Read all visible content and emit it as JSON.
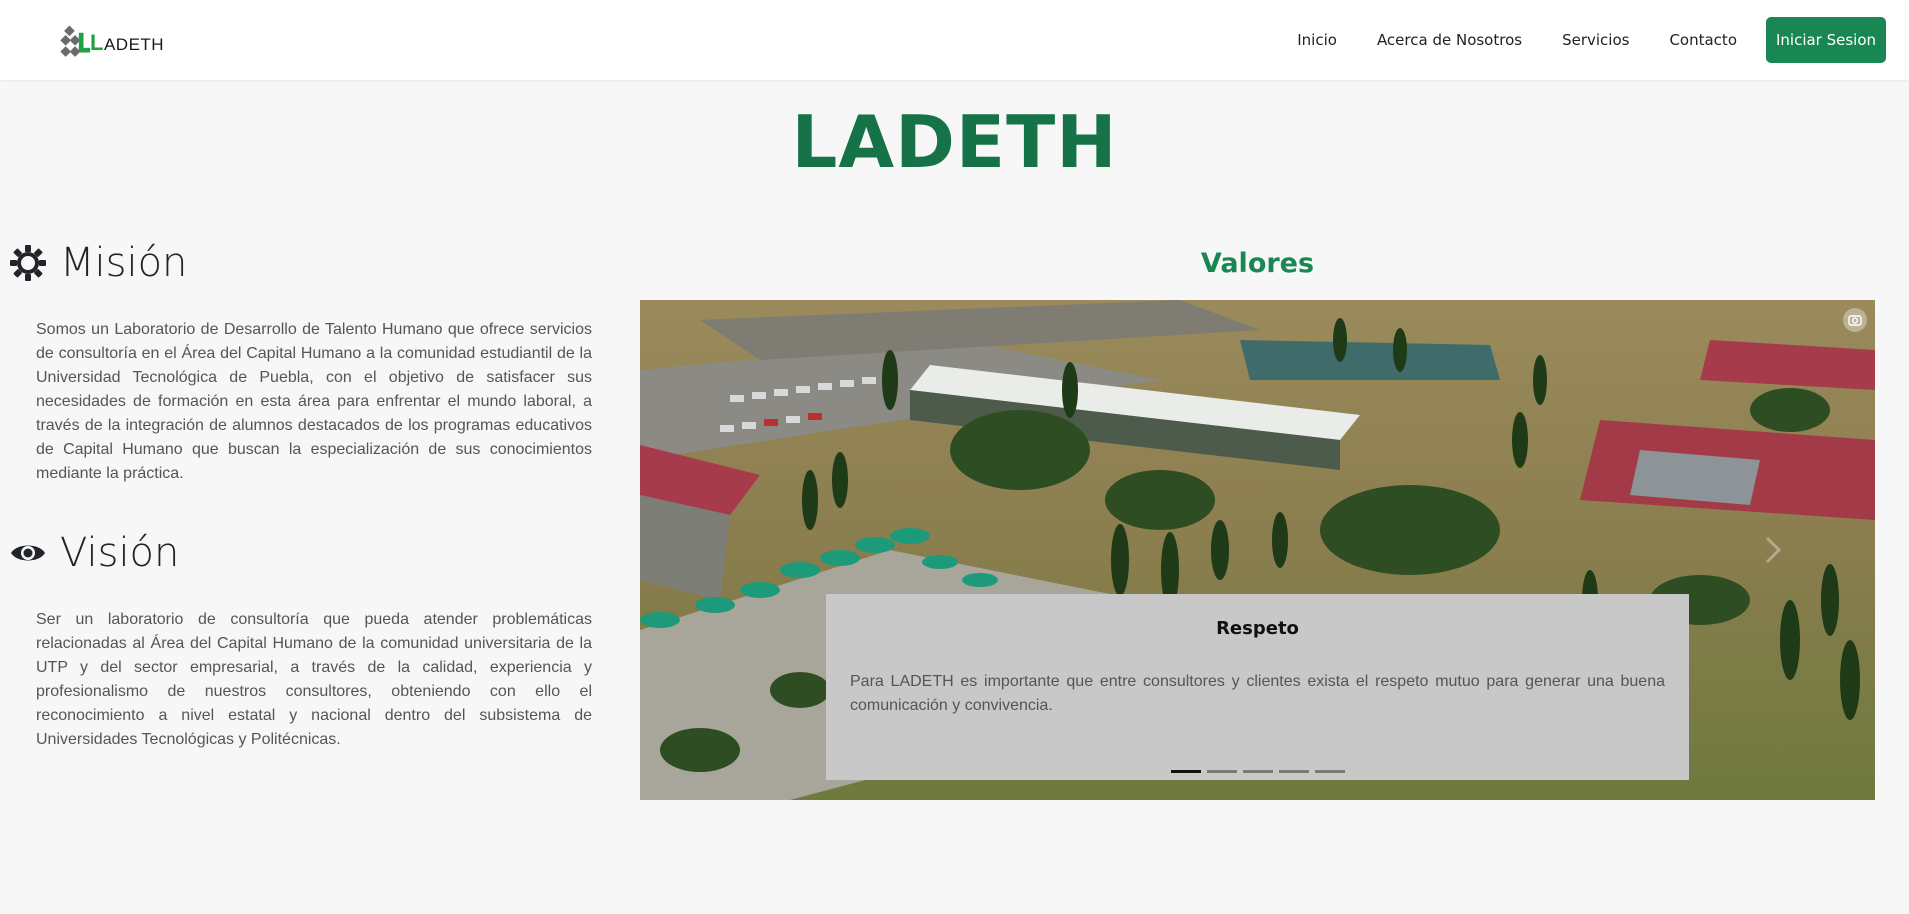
{
  "navbar": {
    "logo_text": "ADETH",
    "logo_letter": "L",
    "links": [
      "Inicio",
      "Acerca de Nosotros",
      "Servicios",
      "Contacto"
    ],
    "login_label": "Iniciar Sesion"
  },
  "hero": {
    "title": "LADETH"
  },
  "mision": {
    "icon": "gear-icon",
    "title": "Misión",
    "text": "Somos un Laboratorio de Desarrollo de Talento Humano que ofrece servicios de consultoría en el Área del Capital Humano a la comunidad estudiantil de la Universidad Tecnológica de Puebla, con el objetivo de satisfacer sus necesidades de formación en esta área para enfrentar el mundo laboral, a través de la integración de alumnos destacados de los programas educativos de Capital Humano que buscan la especialización de sus conocimientos mediante la práctica."
  },
  "vision": {
    "icon": "eye-icon",
    "title": "Visión",
    "text": "Ser un laboratorio de consultoría que pueda atender problemáticas relacionadas al Área del Capital Humano de la comunidad universitaria de la UTP y del sector empresarial, a través de la calidad, experiencia y profesionalismo de nuestros consultores, obteniendo con ello el reconocimiento a nivel estatal y nacional dentro del subsistema de Universidades Tecnológicas y Politécnicas."
  },
  "valores": {
    "title": "Valores",
    "slide_title": "Respeto",
    "slide_text": "Para LADETH es importante que entre consultores y clientes exista el respeto mutuo para generar una buena comunicación y convivencia.",
    "slide_count": 5,
    "active_slide": 0
  },
  "colors": {
    "brand_green": "#157347",
    "button_green": "#198754",
    "caption_bg": "#c8c8c8"
  }
}
